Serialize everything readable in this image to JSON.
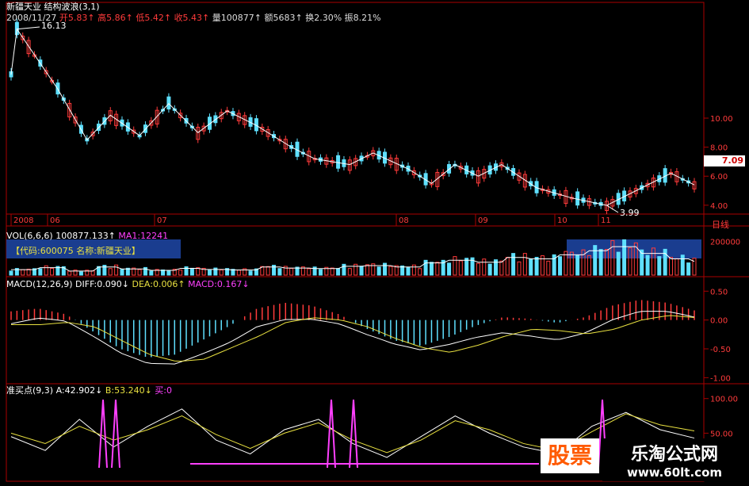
{
  "header": {
    "title": "新疆天业 结构波浪(3,1)",
    "date": "2008/11/27",
    "open": "开5.83↑",
    "high": "高5.86↑",
    "low": "低5.42↑",
    "close": "收5.43↑",
    "volume": "量100877↑",
    "amount": "额5683↑",
    "turnover": "换2.30%",
    "amplitude": "振8.21%"
  },
  "price_panel": {
    "high_label": "16.13",
    "low_label": "3.99",
    "current_price": "7.09",
    "axis_labels": [
      "10.00",
      "8.00",
      "6.00",
      "4.00"
    ],
    "date_labels": [
      "2008",
      "06",
      "07",
      "08",
      "09",
      "10",
      "11"
    ],
    "period": "日线"
  },
  "volume_panel": {
    "title": "VOL(6,6,6)",
    "value": "100877.133↑",
    "ma_label": "MA1:12241",
    "info": "【代码:600075 名称:新疆天业】",
    "axis_label": "200000"
  },
  "macd_panel": {
    "title": "MACD(12,26,9)",
    "diff": "DIFF:0.090↓",
    "dea": "DEA:0.006↑",
    "macd": "MACD:0.167↓",
    "axis_labels": [
      "0.50",
      "0.00",
      "-0.50",
      "-1.00"
    ]
  },
  "zhunmai_panel": {
    "title": "准买点(9,3)",
    "a": "A:42.902↓",
    "b": "B:53.240↓",
    "buy": "买:0",
    "axis_labels": [
      "100.00",
      "50.00"
    ]
  },
  "watermark": {
    "left": "股票",
    "right_title": "乐淘公式网",
    "right_url": "www.60lt.com"
  },
  "colors": {
    "up": "#ff3b3b",
    "down": "#5fe0ff",
    "axis": "#aa0000",
    "yellow": "#e8e040",
    "magenta": "#ff40ff",
    "blue_band": "#1a3d8f"
  },
  "chart_data": [
    {
      "type": "candlestick",
      "title": "新疆天业 结构波浪(3,1)",
      "y_ticks": [
        10.0,
        8.0,
        6.0,
        4.0
      ],
      "x_labels": [
        "2008",
        "06",
        "07",
        "08",
        "09",
        "10",
        "11"
      ],
      "annotations": [
        {
          "label": "16.13"
        },
        {
          "label": "3.99"
        }
      ],
      "wave_points": [
        {
          "x": 0,
          "y": 13.0
        },
        {
          "x": 1,
          "y": 16.13
        },
        {
          "x": 8,
          "y": 12.0
        },
        {
          "x": 13,
          "y": 8.5
        },
        {
          "x": 17,
          "y": 10.2
        },
        {
          "x": 22,
          "y": 8.8
        },
        {
          "x": 27,
          "y": 11.0
        },
        {
          "x": 32,
          "y": 9.0
        },
        {
          "x": 37,
          "y": 10.5
        },
        {
          "x": 42,
          "y": 9.5
        },
        {
          "x": 48,
          "y": 8.0
        },
        {
          "x": 52,
          "y": 7.2
        },
        {
          "x": 58,
          "y": 6.8
        },
        {
          "x": 62,
          "y": 7.6
        },
        {
          "x": 68,
          "y": 6.5
        },
        {
          "x": 72,
          "y": 5.5
        },
        {
          "x": 76,
          "y": 6.8
        },
        {
          "x": 80,
          "y": 6.0
        },
        {
          "x": 84,
          "y": 6.8
        },
        {
          "x": 90,
          "y": 5.2
        },
        {
          "x": 96,
          "y": 4.5
        },
        {
          "x": 102,
          "y": 3.99
        },
        {
          "x": 108,
          "y": 5.2
        },
        {
          "x": 113,
          "y": 6.2
        },
        {
          "x": 117,
          "y": 5.4
        }
      ]
    },
    {
      "type": "bar",
      "title": "VOL(6,6,6)",
      "y_ticks": [
        200000
      ],
      "values": [
        40000,
        55000,
        30000,
        60000,
        45000,
        35000,
        50000,
        42000,
        38000,
        60000,
        52000,
        48000,
        65000,
        70000,
        60000,
        90000,
        110000,
        95000,
        130000,
        120000,
        150000,
        180000,
        210000,
        160000,
        120000,
        100877
      ]
    },
    {
      "type": "bar",
      "title": "MACD(12,26,9)",
      "y_ticks": [
        0.5,
        0.0,
        -0.5,
        -1.0
      ],
      "values": [
        0.15,
        0.2,
        0.1,
        -0.2,
        -0.5,
        -0.65,
        -0.6,
        -0.35,
        -0.1,
        0.2,
        0.3,
        0.25,
        0.1,
        -0.15,
        -0.35,
        -0.45,
        -0.3,
        -0.1,
        0.05,
        0.02,
        -0.05,
        0.05,
        0.25,
        0.35,
        0.3,
        0.167
      ]
    },
    {
      "type": "line",
      "title": "准买点(9,3)",
      "y_ticks": [
        100.0,
        50.0
      ],
      "series": [
        {
          "name": "A",
          "values": [
            45,
            25,
            70,
            30,
            60,
            85,
            40,
            20,
            55,
            70,
            35,
            15,
            45,
            75,
            50,
            30,
            20,
            60,
            80,
            55,
            42.902
          ]
        },
        {
          "name": "B",
          "values": [
            50,
            35,
            60,
            40,
            55,
            75,
            48,
            28,
            50,
            65,
            40,
            22,
            40,
            68,
            55,
            35,
            25,
            52,
            78,
            62,
            53.24
          ]
        }
      ]
    }
  ]
}
